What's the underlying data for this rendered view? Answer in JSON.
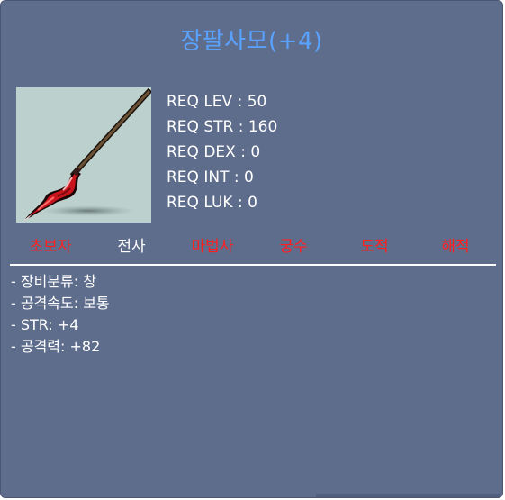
{
  "item": {
    "name": "장팔사모(+4)",
    "icon": "spear-weapon-icon",
    "title_color": "#5aa2ff"
  },
  "requirements": [
    "REQ LEV : 50",
    "REQ STR : 160",
    "REQ DEX : 0",
    "REQ INT : 0",
    "REQ LUK : 0"
  ],
  "jobs": [
    {
      "label": "초보자",
      "allowed": false
    },
    {
      "label": "전사",
      "allowed": true
    },
    {
      "label": "마법사",
      "allowed": false
    },
    {
      "label": "궁수",
      "allowed": false
    },
    {
      "label": "도적",
      "allowed": false
    },
    {
      "label": "해적",
      "allowed": false
    }
  ],
  "stats": [
    "- 장비분류: 창",
    "- 공격속도: 보통",
    "- STR: +4",
    "- 공격력: +82"
  ],
  "colors": {
    "panel_bg": "#5f6d8c",
    "job_allowed": "#ffffff",
    "job_disallowed": "#ff1f1f"
  }
}
